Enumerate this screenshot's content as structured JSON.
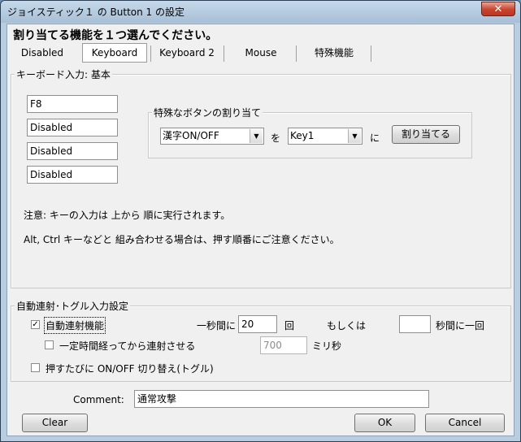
{
  "window": {
    "title": "ジョイスティック１ の Button 1 の設定",
    "close_glyph": "✕"
  },
  "instruction": "割り当てる機能を１つ選んでください。",
  "tabs": [
    {
      "label": "Disabled"
    },
    {
      "label": "Keyboard"
    },
    {
      "label": "Keyboard 2"
    },
    {
      "label": "Mouse"
    },
    {
      "label": "特殊機能"
    }
  ],
  "selected_tab": "Keyboard",
  "keyboard_group": {
    "title": "キーボード入力: 基本",
    "key_fields": [
      "F8",
      "Disabled",
      "Disabled",
      "Disabled"
    ],
    "special_group": {
      "title": "特殊なボタンの割り当て",
      "combo1_value": "漢字ON/OFF",
      "wo": "を",
      "combo2_value": "Key1",
      "ni": "に",
      "assign_button": "割り当てる"
    },
    "note1": "注意: キーの入力は 上から 順に実行されます。",
    "note2": "Alt, Ctrl キーなどと 組み合わせる場合は、押す順番にご注意ください。"
  },
  "turbo_group": {
    "title": "自動連射･トグル入力設定",
    "auto_fire_label": "自動連射機能",
    "auto_fire_checked": true,
    "per_second_prefix": "一秒間に",
    "per_second_value": "20",
    "per_second_unit": "回",
    "or_label": "もしくは",
    "seconds_value": "",
    "seconds_suffix": "秒間に一回",
    "delay_label": "一定時間経ってから連射させる",
    "delay_checked": false,
    "delay_value": "700",
    "delay_unit": "ミリ秒",
    "toggle_label": "押すたびに ON/OFF 切り替え(トグル)",
    "toggle_checked": false
  },
  "comment": {
    "label": "Comment:",
    "value": "通常攻撃"
  },
  "buttons": {
    "clear": "Clear",
    "ok": "OK",
    "cancel": "Cancel"
  }
}
